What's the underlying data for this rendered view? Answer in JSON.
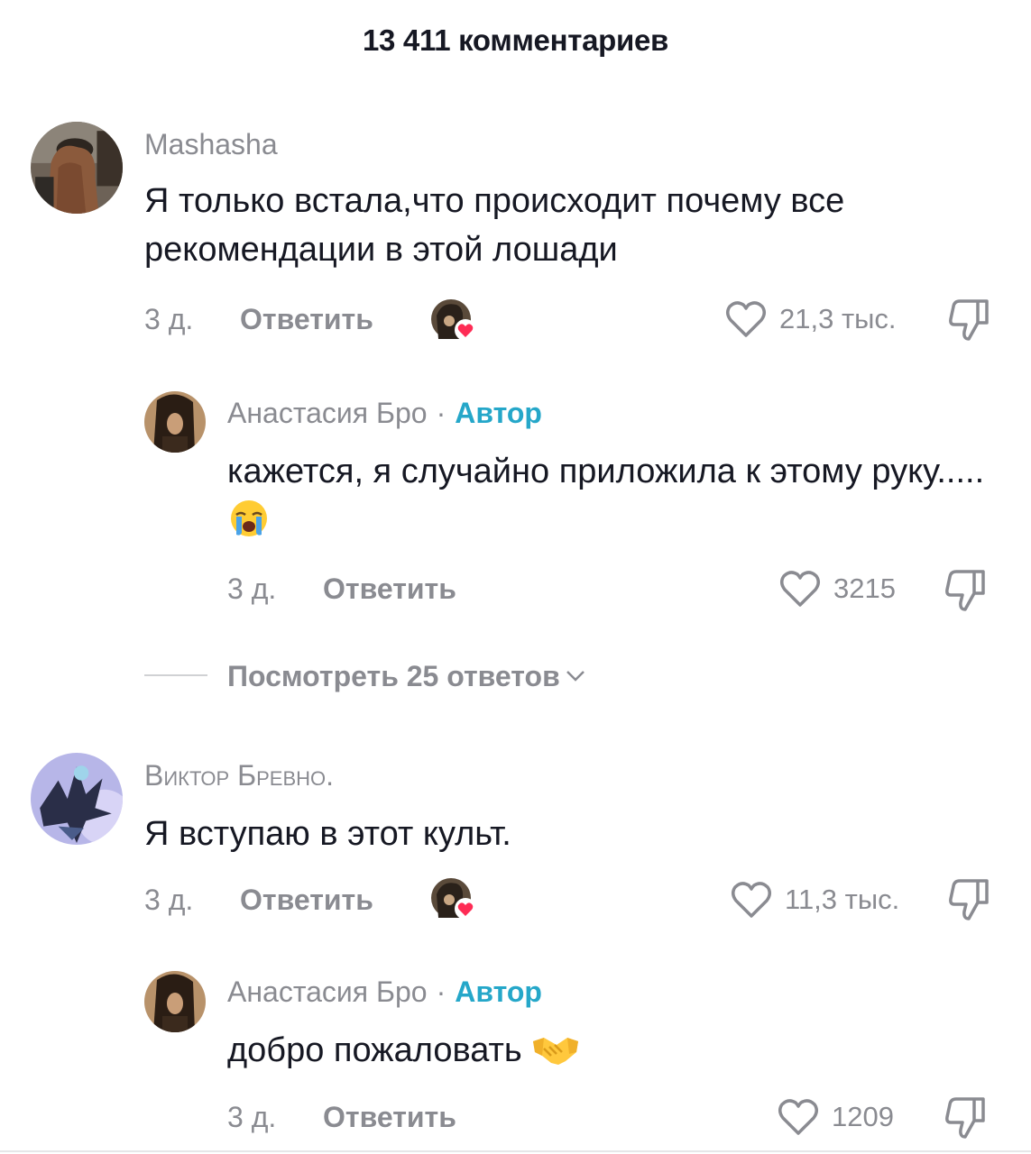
{
  "header": {
    "title": "13 411 комментариев"
  },
  "comments": [
    {
      "username": "Mashasha",
      "text": "Я только встала,что происходит почему все рекомендации в этой лошади",
      "time": "3 д.",
      "reply_label": "Ответить",
      "likes": "21,3 тыс.",
      "liked_by_creator": true,
      "icons": [
        "heart-outline-icon",
        "dislike-icon"
      ]
    },
    {
      "username": "Анастасия Бро",
      "separator": "·",
      "badge": "Автор",
      "text": "кажется, я случайно приложила к этому руку.....",
      "emoji": "loudly-crying-face-emoji",
      "time": "3 д.",
      "reply_label": "Ответить",
      "likes": "3215"
    },
    {
      "username": "Виктор Бревно.",
      "text": "Я вступаю в этот культ.",
      "time": "3 д.",
      "reply_label": "Ответить",
      "likes": "11,3 тыс.",
      "liked_by_creator": true
    },
    {
      "username": "Анастасия Бро",
      "separator": "·",
      "badge": "Автор",
      "text": "добро пожаловать",
      "emoji": "handshake-emoji",
      "time": "3 д.",
      "reply_label": "Ответить",
      "likes": "1209"
    }
  ],
  "view_replies": {
    "label": "Посмотреть 25 ответов"
  },
  "colors": {
    "text": "#161823",
    "muted": "#8a8b91",
    "author_badge": "#25a7c9",
    "heart_badge": "#fe2c55"
  }
}
